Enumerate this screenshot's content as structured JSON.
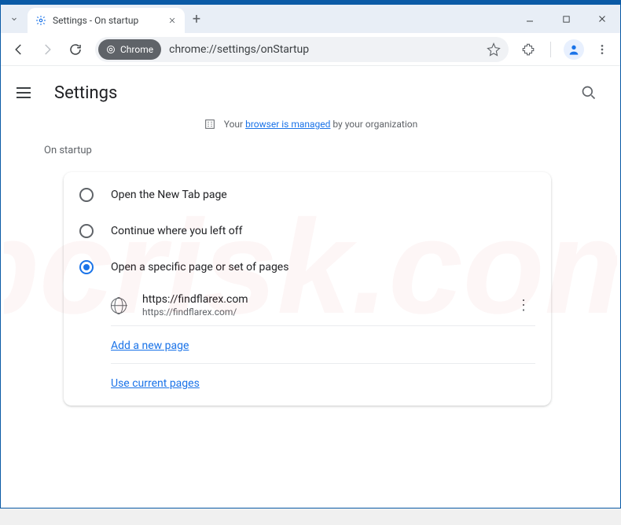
{
  "window": {
    "tab_title": "Settings - On startup",
    "chrome_chip_label": "Chrome",
    "url": "chrome://settings/onStartup"
  },
  "page_header": {
    "title": "Settings"
  },
  "managed_banner": {
    "prefix": "Your ",
    "link": "browser is managed",
    "suffix": " by your organization"
  },
  "section": {
    "title": "On startup",
    "options": [
      {
        "label": "Open the New Tab page",
        "checked": false
      },
      {
        "label": "Continue where you left off",
        "checked": false
      },
      {
        "label": "Open a specific page or set of pages",
        "checked": true
      }
    ],
    "startup_pages": [
      {
        "display": "https://findflarex.com",
        "full_url": "https://findflarex.com/"
      }
    ],
    "add_page_label": "Add a new page",
    "use_current_label": "Use current pages"
  },
  "watermark": "pcrisk.com"
}
